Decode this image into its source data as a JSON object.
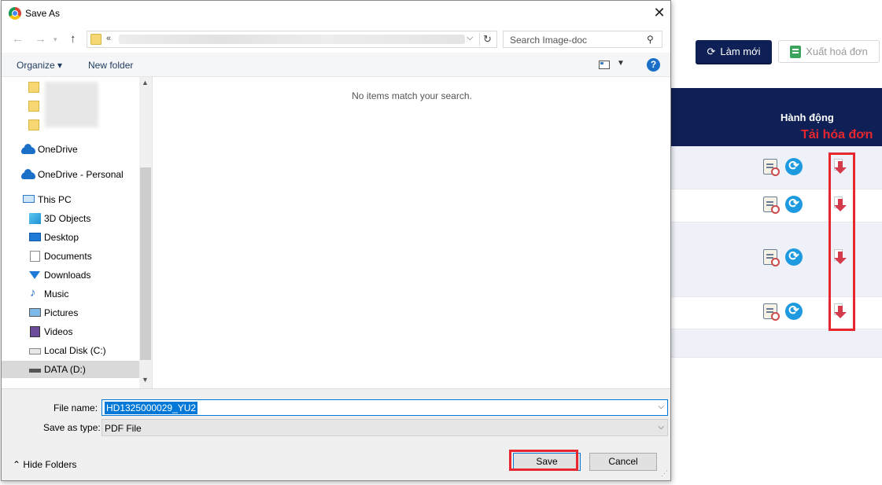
{
  "background_page": {
    "refresh_button": "Làm mới",
    "export_invoice_button": "Xuất hoá đơn",
    "table_header_action": "Hành động",
    "annotation": "Tải hóa đơn",
    "annotation_color": "#e8262e",
    "header_color": "#0e2055"
  },
  "dialog": {
    "title": "Save As",
    "close_label": "✕",
    "address": {
      "chevron": "«"
    },
    "search_placeholder": "Search Image-doc",
    "toolbar": {
      "organize_label": "Organize ▾",
      "new_folder_label": "New folder",
      "help_label": "?"
    },
    "nav_items": [
      {
        "label": "OneDrive"
      },
      {
        "label": "OneDrive - Personal"
      },
      {
        "label": "This PC"
      },
      {
        "label": "3D Objects"
      },
      {
        "label": "Desktop"
      },
      {
        "label": "Documents"
      },
      {
        "label": "Downloads"
      },
      {
        "label": "Music"
      },
      {
        "label": "Pictures"
      },
      {
        "label": "Videos"
      },
      {
        "label": "Local Disk (C:)"
      },
      {
        "label": "DATA (D:)",
        "selected": true
      }
    ],
    "empty_message": "No items match your search.",
    "file_name_label": "File name:",
    "file_name_value": "HD1325000029_YU2",
    "save_as_type_label": "Save as type:",
    "save_as_type_value": "PDF File",
    "hide_folders_label": "Hide Folders",
    "save_button": "Save",
    "cancel_button": "Cancel",
    "accent_color": "#0078d7"
  }
}
